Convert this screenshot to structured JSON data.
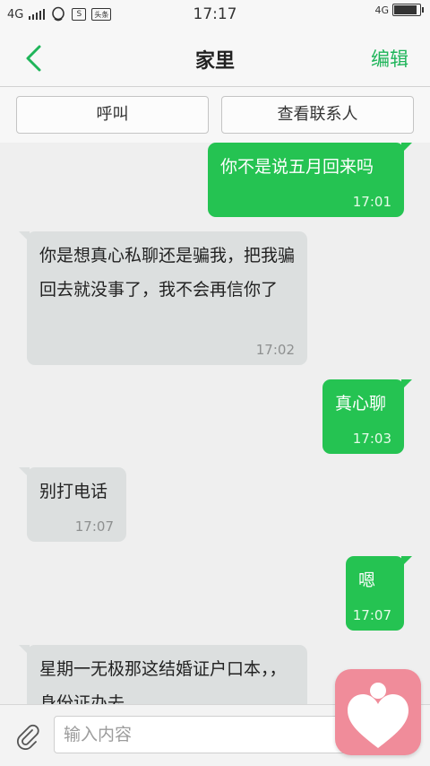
{
  "status_bar": {
    "network_left": "4G",
    "time": "17:17",
    "network_right": "4G",
    "news_icon_text": "头条"
  },
  "header": {
    "title": "家里",
    "edit_label": "编辑",
    "accent_color": "#1fb55a"
  },
  "actions": {
    "call_label": "呼叫",
    "view_contact_label": "查看联系人"
  },
  "messages": [
    {
      "direction": "out",
      "text": "你不是说五月回来吗",
      "time": "17:01"
    },
    {
      "direction": "in",
      "text": "你是想真心私聊还是骗我，把我骗回去就没事了，我不会再信你了",
      "time": "17:02"
    },
    {
      "direction": "out",
      "text": "真心聊",
      "time": "17:03"
    },
    {
      "direction": "in",
      "text": "别打电话",
      "time": "17:07"
    },
    {
      "direction": "out",
      "text": "嗯",
      "time": "17:07"
    },
    {
      "direction": "in",
      "text": "星期一无极那这结婚证户口本，，身份证办去",
      "time": ""
    }
  ],
  "input": {
    "placeholder": "输入内容",
    "value": ""
  },
  "colors": {
    "outgoing_bubble": "#25c352",
    "incoming_bubble": "#dcdfdf",
    "app_icon_bg": "#f08c9a"
  }
}
